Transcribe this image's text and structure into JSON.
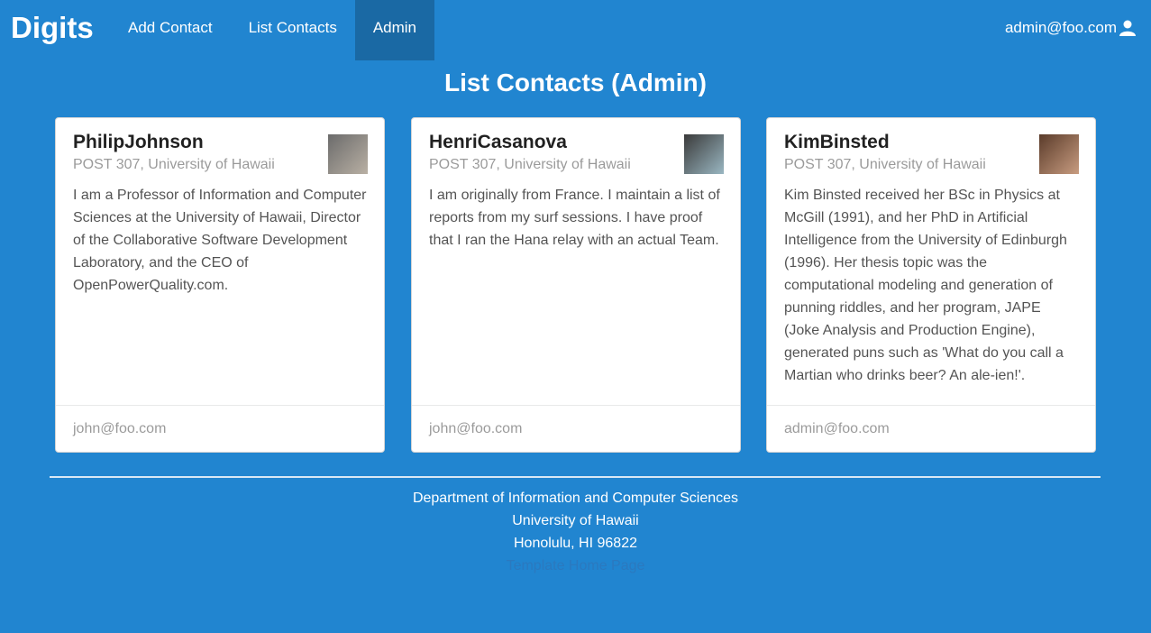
{
  "navbar": {
    "brand": "Digits",
    "items": [
      {
        "label": "Add Contact"
      },
      {
        "label": "List Contacts"
      },
      {
        "label": "Admin"
      }
    ],
    "user": "admin@foo.com",
    "user_icon": "user-icon"
  },
  "page": {
    "title": "List Contacts (Admin)"
  },
  "contacts": [
    {
      "name": "PhilipJohnson",
      "address": "POST 307, University of Hawaii",
      "description": "I am a Professor of Information and Computer Sciences at the University of Hawaii, Director of the Collaborative Software Development Laboratory, and the CEO of OpenPowerQuality.com.",
      "owner": "john@foo.com"
    },
    {
      "name": "HenriCasanova",
      "address": "POST 307, University of Hawaii",
      "description": "I am originally from France. I maintain a list of reports from my surf sessions. I have proof that I ran the Hana relay with an actual Team.",
      "owner": "john@foo.com"
    },
    {
      "name": "KimBinsted",
      "address": "POST 307, University of Hawaii",
      "description": "Kim Binsted received her BSc in Physics at McGill (1991), and her PhD in Artificial Intelligence from the University of Edinburgh (1996). Her thesis topic was the computational modeling and generation of punning riddles, and her program, JAPE (Joke Analysis and Production Engine), generated puns such as 'What do you call a Martian who drinks beer? An ale-ien!'.",
      "owner": "admin@foo.com"
    }
  ],
  "footer": {
    "line1": "Department of Information and Computer Sciences",
    "line2": "University of Hawaii",
    "line3": "Honolulu, HI 96822",
    "link": "Template Home Page"
  },
  "colors": {
    "background": "#2185d0",
    "active_nav": "#1a69a4",
    "card": "#ffffff"
  }
}
